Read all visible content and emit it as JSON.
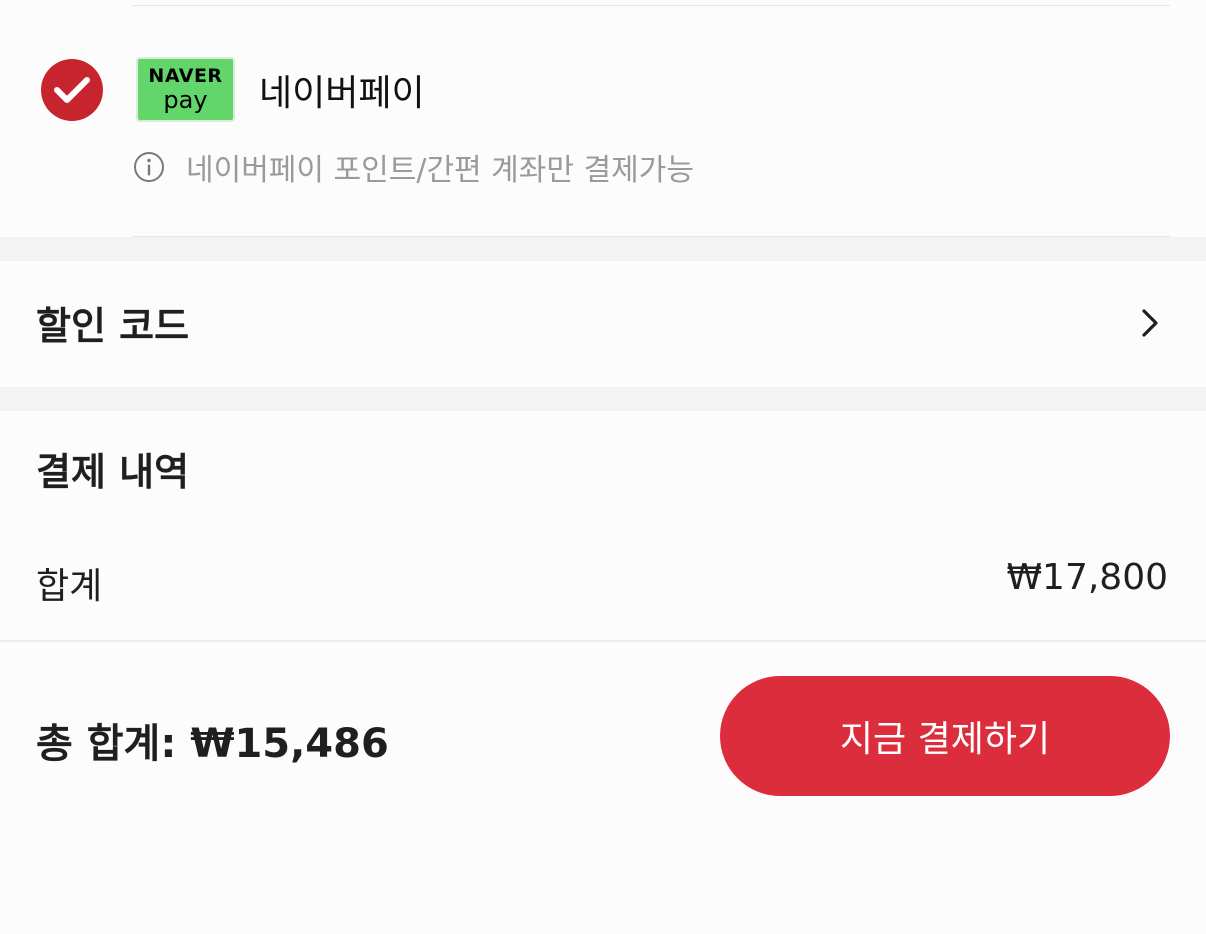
{
  "payment_method": {
    "selected": true,
    "logo_line1": "NAVER",
    "logo_line2": "pay",
    "name": "네이버페이",
    "info": "네이버페이 포인트/간편 계좌만 결제가능",
    "check_color": "#c8242d",
    "logo_color": "#63d66b",
    "check_icon": "check-icon",
    "info_icon": "info-icon"
  },
  "discount": {
    "label": "할인 코드",
    "chevron_icon": "chevron-right-icon"
  },
  "summary": {
    "title": "결제 내역",
    "subtotal_label": "합계",
    "subtotal_value": "₩17,800"
  },
  "footer": {
    "total_label": "총 합계:",
    "total_value": "₩15,486",
    "pay_button": "지금 결제하기",
    "button_color": "#dc2d3c"
  }
}
